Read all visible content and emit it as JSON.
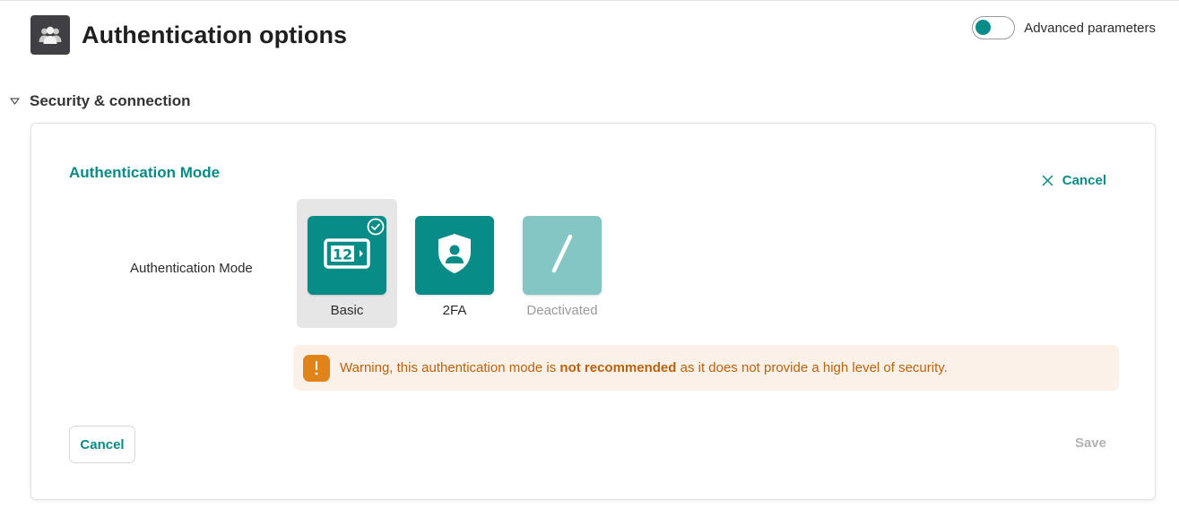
{
  "header": {
    "title": "Authentication options",
    "icon": "users-icon",
    "advanced_label": "Advanced parameters",
    "advanced_enabled": false
  },
  "section": {
    "title": "Security & connection",
    "expanded": true,
    "card": {
      "title": "Authentication Mode",
      "cancel_top_label": "Cancel",
      "field_label": "Authentication Mode",
      "modes": [
        {
          "label": "Basic",
          "icon": "numeric-keypad-icon",
          "selected": true,
          "disabled": false
        },
        {
          "label": "2FA",
          "icon": "shield-user-icon",
          "selected": false,
          "disabled": false
        },
        {
          "label": "Deactivated",
          "icon": "slash-icon",
          "selected": false,
          "disabled": true
        }
      ],
      "warning": {
        "prefix": "Warning, this authentication mode is ",
        "emphasis": "not recommended",
        "suffix": " as it does not provide a high level of security.",
        "icon": "exclamation-icon"
      },
      "cancel_label": "Cancel",
      "save_label": "Save"
    }
  },
  "colors": {
    "accent": "#0a8a85",
    "tile": "#078c87",
    "tile_disabled": "#84c6c4",
    "warning_bg": "#fcf1e8",
    "warning_text": "#b9620c",
    "warning_icon": "#e0841a"
  }
}
